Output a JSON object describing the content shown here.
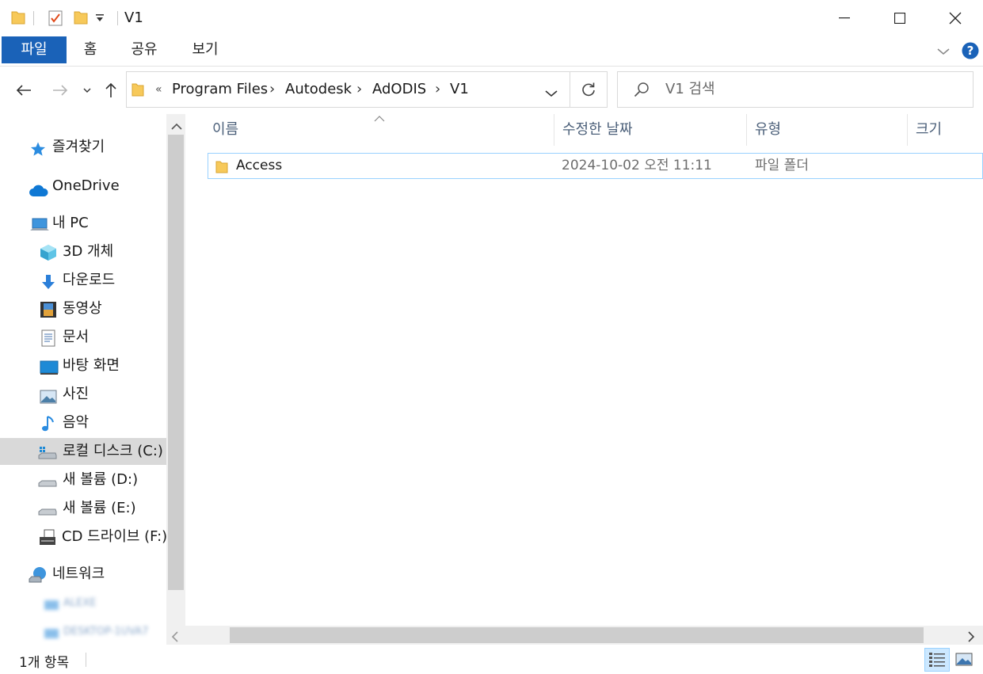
{
  "window": {
    "title": "V1",
    "minimize_glyph": "—",
    "maximize_glyph": "☐",
    "close_glyph": "✕"
  },
  "ribbon": {
    "tabs": [
      {
        "label": "파일",
        "active": true
      },
      {
        "label": "홈"
      },
      {
        "label": "공유"
      },
      {
        "label": "보기"
      }
    ],
    "help_glyph": "?"
  },
  "address": {
    "overflow": "«",
    "breadcrumb": [
      "Program Files",
      "Autodesk",
      "AdODIS",
      "V1"
    ],
    "separator": "›"
  },
  "search": {
    "placeholder": "V1 검색"
  },
  "nav": {
    "quick_access": "즐겨찾기",
    "onedrive": "OneDrive",
    "this_pc": "내 PC",
    "pc_items": [
      "3D 개체",
      "다운로드",
      "동영상",
      "문서",
      "바탕 화면",
      "사진",
      "음악",
      "로컬 디스크 (C:)",
      "새 볼륨 (D:)",
      "새 볼륨 (E:)",
      "CD 드라이브 (F:)"
    ],
    "network": "네트워크",
    "network_items": [
      "ALEXE",
      "DESKTOP-1UVA7"
    ],
    "selected": "로컬 디스크 (C:)"
  },
  "columns": {
    "name": "이름",
    "modified": "수정한 날짜",
    "type": "유형",
    "size": "크기"
  },
  "files": [
    {
      "name": "Access",
      "modified": "2024-10-02 오전 11:11",
      "type": "파일 폴더",
      "size": ""
    }
  ],
  "status": {
    "count": "1개 항목"
  },
  "colors": {
    "accent": "#1a62b8",
    "folder": "#f7c95a",
    "selection": "#d9d9d9",
    "row_border": "#99d1ff",
    "header_text": "#4c607a"
  }
}
